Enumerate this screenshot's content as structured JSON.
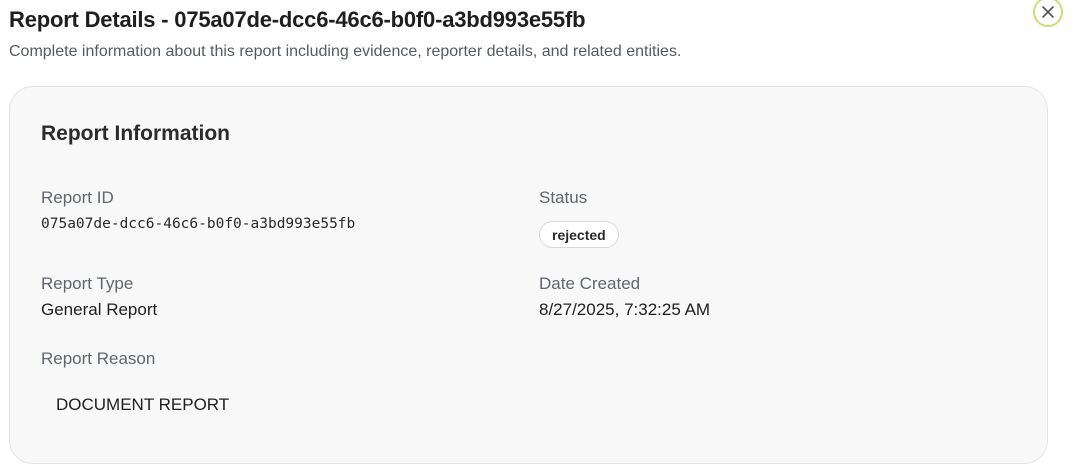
{
  "dialog": {
    "title": "Report Details - 075a07de-dcc6-46c6-b0f0-a3bd993e55fb",
    "subtitle": "Complete information about this report including evidence, reporter details, and related entities.",
    "close_icon": "close-icon"
  },
  "report_info": {
    "heading": "Report Information",
    "report_id_label": "Report ID",
    "report_id_value": "075a07de-dcc6-46c6-b0f0-a3bd993e55fb",
    "status_label": "Status",
    "status_value": "rejected",
    "report_type_label": "Report Type",
    "report_type_value": "General Report",
    "date_created_label": "Date Created",
    "date_created_value": "8/27/2025, 7:32:25 AM",
    "report_reason_label": "Report Reason",
    "report_reason_value": "DOCUMENT REPORT"
  },
  "colors": {
    "close_ring": "#c6df7c",
    "card_background": "#f8f8f8"
  }
}
